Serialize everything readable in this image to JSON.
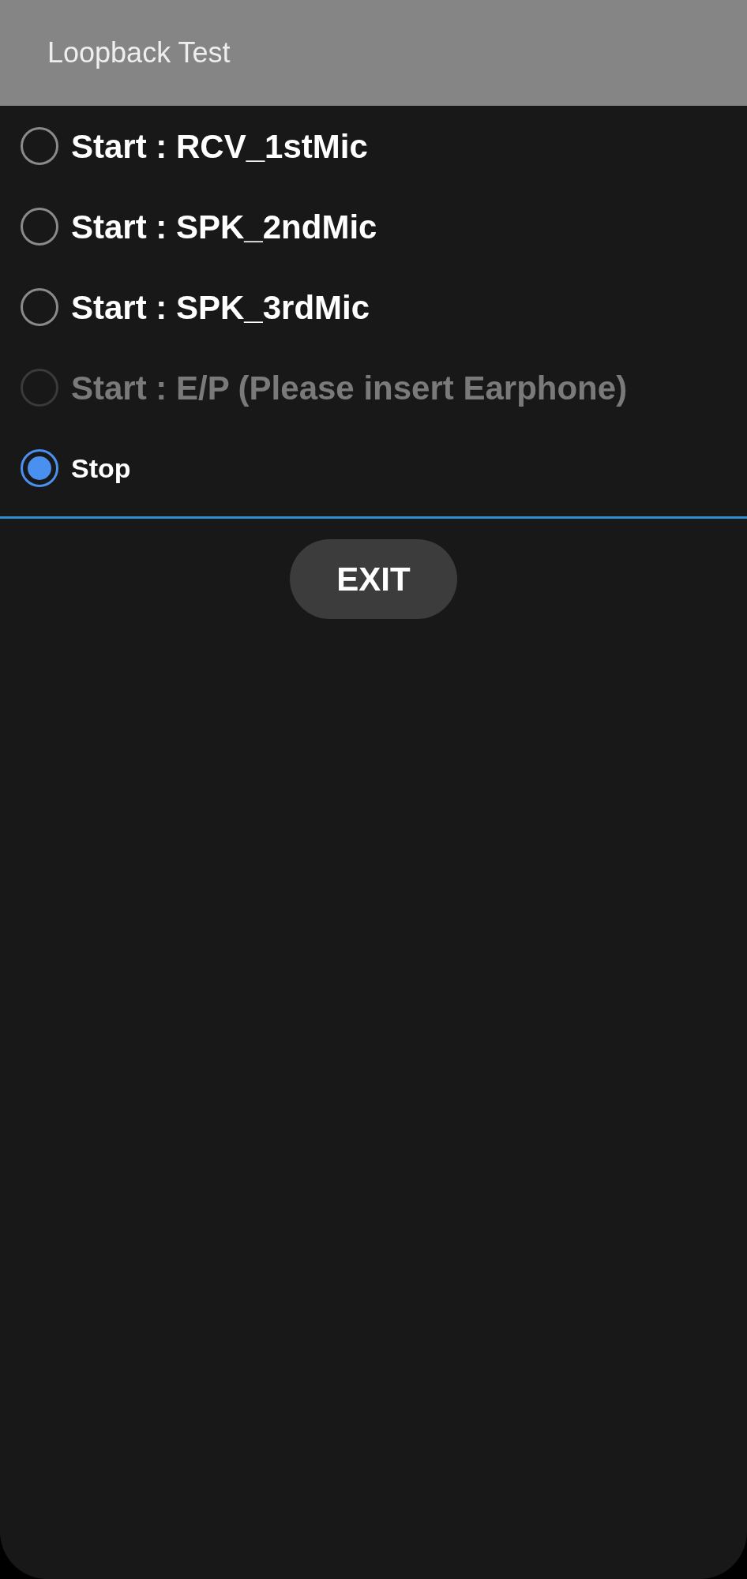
{
  "title": "Loopback Test",
  "options": [
    {
      "label": "Start : RCV_1stMic",
      "kind": "start",
      "selected": false,
      "disabled": false
    },
    {
      "label": "Start : SPK_2ndMic",
      "kind": "start",
      "selected": false,
      "disabled": false
    },
    {
      "label": "Start : SPK_3rdMic",
      "kind": "start",
      "selected": false,
      "disabled": false
    },
    {
      "label": "Start : E/P (Please insert Earphone)",
      "kind": "start",
      "selected": false,
      "disabled": true
    },
    {
      "label": "Stop",
      "kind": "stop",
      "selected": true,
      "disabled": false
    }
  ],
  "exit_button": "EXIT"
}
